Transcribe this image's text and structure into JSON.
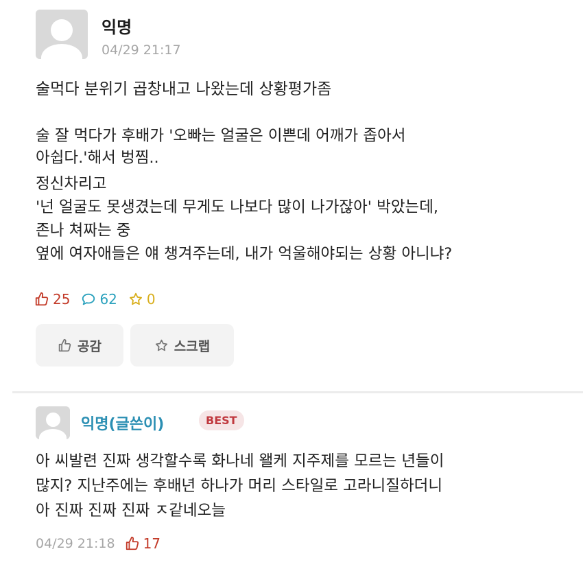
{
  "post": {
    "author": "익명",
    "time": "04/29 21:17",
    "title": "술먹다 분위기 곱창내고 나왔는데 상황평가좀",
    "body_lines": [
      "술 잘 먹다가 후배가 '오빠는 얼굴은 이쁜데 어깨가 좁아서",
      "아쉽다.'해서 벙찜..",
      "정신차리고",
      "'넌 얼굴도 못생겼는데 무게도 나보다 많이 나가잖아' 박았는데,",
      "존나 쳐짜는 중",
      "옆에 여자애들은 얘 챙겨주는데, 내가 억울해야되는 상황 아니냐?"
    ],
    "likes": "25",
    "comments": "62",
    "scraps": "0",
    "like_button": "공감",
    "scrap_button": "스크랩"
  },
  "comment": {
    "author": "익명(글쓴이)",
    "badge": "BEST",
    "lines": [
      "아 씨발련 진짜 생각할수록 화나네 왤케 지주제를 모르는 년들이",
      "많지? 지난주에는 후배년 하나가 머리 스타일로 고라니질하더니",
      "아 진짜 진짜 진짜 ㅈ같네오늘"
    ],
    "time": "04/29 21:18",
    "likes": "17"
  },
  "colors": {
    "like": "#c33b29",
    "comment": "#2aa1bd",
    "scrap": "#d8ae1b",
    "author_highlight": "#2b8fb3",
    "best_badge": "#c0393f"
  },
  "icons": [
    "avatar-placeholder",
    "thumbs-up-icon",
    "speech-bubble-icon",
    "star-icon"
  ]
}
